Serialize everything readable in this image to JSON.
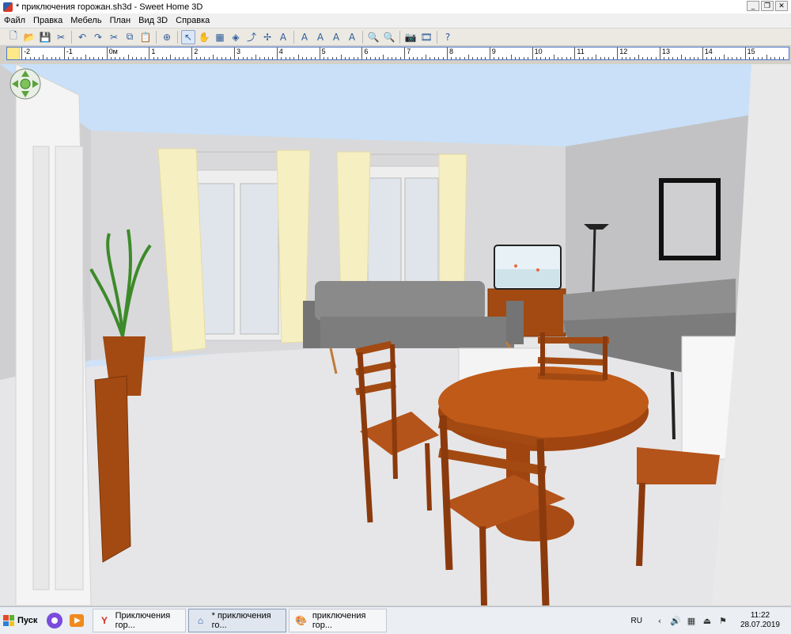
{
  "window": {
    "title": "* приключения горожан.sh3d - Sweet Home 3D"
  },
  "window_controls": {
    "minimize": "_",
    "maximize": "❐",
    "close": "✕"
  },
  "menu": [
    "Файл",
    "Правка",
    "Мебель",
    "План",
    "Вид 3D",
    "Справка"
  ],
  "toolbar": {
    "buttons": [
      {
        "name": "new-home-icon",
        "glyph": "🗋"
      },
      {
        "name": "open-icon",
        "glyph": "📂"
      },
      {
        "name": "save-icon",
        "glyph": "💾"
      },
      {
        "name": "preferences-icon",
        "glyph": "✂"
      },
      {
        "sep": true
      },
      {
        "name": "undo-icon",
        "glyph": "↶"
      },
      {
        "name": "redo-icon",
        "glyph": "↷"
      },
      {
        "name": "cut-icon",
        "glyph": "✂"
      },
      {
        "name": "copy-icon",
        "glyph": "⧉"
      },
      {
        "name": "paste-icon",
        "glyph": "📋"
      },
      {
        "sep": true
      },
      {
        "name": "add-furniture-icon",
        "glyph": "⊕"
      },
      {
        "sep": true
      },
      {
        "name": "select-mode-icon",
        "glyph": "↖",
        "selected": true
      },
      {
        "name": "pan-mode-icon",
        "glyph": "✋"
      },
      {
        "name": "create-walls-icon",
        "glyph": "▦"
      },
      {
        "name": "create-rooms-icon",
        "glyph": "◈"
      },
      {
        "name": "create-polylines-icon",
        "glyph": "⤴"
      },
      {
        "name": "create-dimensions-icon",
        "glyph": "✢"
      },
      {
        "name": "add-text-icon",
        "glyph": "A"
      },
      {
        "sep": true
      },
      {
        "name": "increase-text-icon",
        "glyph": "A"
      },
      {
        "name": "decrease-text-icon",
        "glyph": "A"
      },
      {
        "name": "bold-text-icon",
        "glyph": "A"
      },
      {
        "name": "italic-text-icon",
        "glyph": "A"
      },
      {
        "sep": true
      },
      {
        "name": "zoom-in-icon",
        "glyph": "🔍"
      },
      {
        "name": "zoom-out-icon",
        "glyph": "🔍"
      },
      {
        "sep": true
      },
      {
        "name": "create-photo-icon",
        "glyph": "📷"
      },
      {
        "name": "create-video-icon",
        "glyph": "🎞"
      },
      {
        "sep": true
      },
      {
        "name": "help-icon",
        "glyph": "?"
      }
    ]
  },
  "ruler": {
    "labels": [
      "-2",
      "-1",
      "0м",
      "1",
      "2",
      "3",
      "4",
      "5",
      "6",
      "7",
      "8",
      "9",
      "10",
      "11",
      "12",
      "13",
      "14",
      "15"
    ]
  },
  "taskbar": {
    "start_label": "Пуск",
    "tasks": [
      {
        "label": "Приключения гор...",
        "icon": "yandex-browser-icon",
        "glyph": "Y",
        "color": "#d52b1e",
        "active": false
      },
      {
        "label": "* приключения го...",
        "icon": "sweet-home-3d-icon",
        "glyph": "⌂",
        "color": "#2c5ea8",
        "active": true
      },
      {
        "label": "приключения гор...",
        "icon": "paint-icon",
        "glyph": "🎨",
        "color": "#555",
        "active": false
      }
    ],
    "language": "RU",
    "time": "11:22",
    "date": "28.07.2019"
  }
}
